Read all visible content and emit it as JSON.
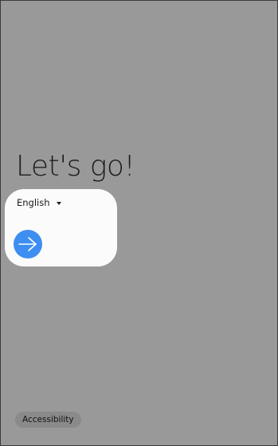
{
  "welcome": {
    "title": "Let's go!"
  },
  "language": {
    "selected": "English"
  },
  "next": {
    "icon": "arrow-right-icon",
    "color": "#3d8ef0"
  },
  "footer": {
    "accessibility_label": "Accessibility"
  },
  "colors": {
    "background": "#999999",
    "card": "#fbfbfb"
  }
}
